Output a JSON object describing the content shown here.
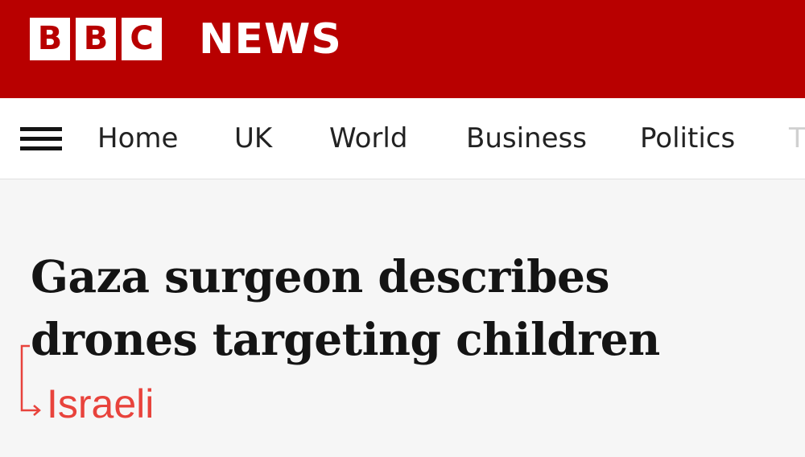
{
  "masthead": {
    "brand_letters": [
      "B",
      "B",
      "C"
    ],
    "brand_word": "NEWS",
    "background_color": "#b80000"
  },
  "nav": {
    "menu_icon": "hamburger-menu-icon",
    "items": [
      {
        "label": "Home"
      },
      {
        "label": "UK"
      },
      {
        "label": "World"
      },
      {
        "label": "Business"
      },
      {
        "label": "Politics"
      }
    ],
    "overflow_item": "T"
  },
  "article": {
    "headline_line1": "Gaza surgeon describes",
    "headline_line2": "drones targeting children"
  },
  "annotation": {
    "text": "Israeli",
    "color": "#e8433c",
    "icon": "insert-arrow-icon"
  }
}
